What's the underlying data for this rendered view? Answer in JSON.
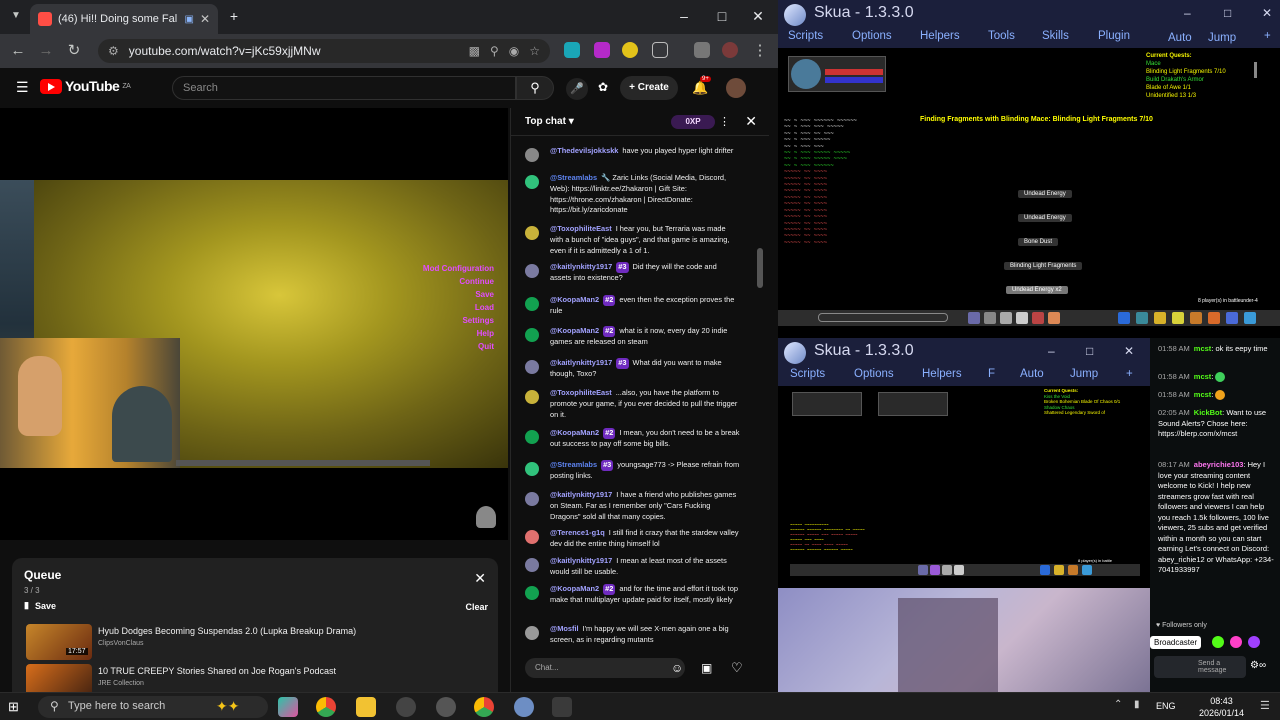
{
  "chrome": {
    "tab_title": "(46) Hi!! Doing some Fallout",
    "url": "youtube.com/watch?v=jKc59xjjMNw"
  },
  "youtube": {
    "logo": "YouTube",
    "region": "ZA",
    "search_placeholder": "Search",
    "create_label": "Create",
    "notif_count": "9+"
  },
  "video": {
    "game_menu": [
      "Mod Configuration",
      "Continue",
      "Save",
      "Load",
      "Settings",
      "Help",
      "Quit"
    ]
  },
  "queue": {
    "title": "Queue",
    "count": "3 / 3",
    "save": "Save",
    "clear": "Clear",
    "items": [
      {
        "title": "Hyub Dodges Becoming Suspendas 2.0 (Lupka Breakup Drama)",
        "channel": "ClipsVonClaus",
        "duration": "17:57"
      },
      {
        "title": "10 TRUE CREEPY Stories Shared on Joe Rogan's Podcast",
        "channel": "JRE Collection",
        "duration": ""
      }
    ]
  },
  "chat": {
    "header": "Top chat",
    "xp": "0XP",
    "input_placeholder": "Chat...",
    "messages": [
      {
        "author": "@Thedevilsjokkskk",
        "badge": "",
        "text": "have you played hyper light drifter"
      },
      {
        "author": "@Streamlabs",
        "badge": "",
        "text": "Zaric Links (Social Media, Discord, Web): https://linktr.ee/Zhakaron | Gift Site: https://throne.com/zhakaron | DirectDonate: https://bit.ly/zaricdonate"
      },
      {
        "author": "@ToxophiliteEast",
        "badge": "",
        "text": "I hear you, but Terraria was made with a bunch of \"idea guys\", and that game is amazing, even if it is admittedly a 1 of 1."
      },
      {
        "author": "@kaitlynkitty1917",
        "badge": "#3",
        "text": "Did they will the code and assets into existence?"
      },
      {
        "author": "@KoopaMan2",
        "badge": "#2",
        "text": "even then the exception proves the rule"
      },
      {
        "author": "@KoopaMan2",
        "badge": "#2",
        "text": "what is it now, every day 20 indie games are released on steam"
      },
      {
        "author": "@kaitlynkitty1917",
        "badge": "#3",
        "text": "What did you want to make though, Toxo?"
      },
      {
        "author": "@ToxophiliteEast",
        "badge": "",
        "text": "...also, you have the platform to promote your game, if you ever decided to pull the trigger on it."
      },
      {
        "author": "@KoopaMan2",
        "badge": "#2",
        "text": "I mean, you don't need to be a break out success to pay off some big bills."
      },
      {
        "author": "@Streamlabs",
        "badge": "#3",
        "text": "youngsage773 -> Please refrain from posting links."
      },
      {
        "author": "@kaitlynkitty1917",
        "badge": "",
        "text": "I have a friend who publishes games on Steam. Far as I remember only \"Cars Fucking Dragons\" sold all that many copies."
      },
      {
        "author": "@Terence1-g1q",
        "badge": "",
        "text": "I still find it crazy that the stardew valley dev did the entire thing himself lol"
      },
      {
        "author": "@kaitlynkitty1917",
        "badge": "",
        "text": "I mean at least most of the assets would still be usable."
      },
      {
        "author": "@KoopaMan2",
        "badge": "#2",
        "text": "and for the time and effort it took top make that multiplayer update paid for itself, mostly likely"
      },
      {
        "author": "@Mosfil",
        "badge": "",
        "text": "I'm happy we will see X-men again one a big screen, as in regarding mutants"
      }
    ]
  },
  "skua1": {
    "title": "Skua - 1.3.3.0",
    "menu": [
      "Scripts",
      "Options",
      "Helpers",
      "Tools",
      "Skills",
      "Plugin",
      "Auto",
      "Jump"
    ],
    "quest_header": "Current Quests:",
    "quests": [
      "Mace",
      "Blinding Light Fragments 7/10",
      "Build Drakath's Armor",
      "Blade of Awe 1/1",
      "Unidentified 13 1/3"
    ],
    "objective": "Finding Fragments with Blinding Mace: Blinding Light Fragments 7/10",
    "drops": [
      "Undead Energy",
      "Undead Energy",
      "Bone Dust",
      "Blinding Light Fragments",
      "Undead Energy x2"
    ],
    "players": "8 player(s) in battleunder-4"
  },
  "skua2": {
    "title": "Skua - 1.3.3.0",
    "menu": [
      "Scripts",
      "Options",
      "Helpers",
      "F",
      "Auto",
      "Jump"
    ],
    "quest_header": "Current Quests:",
    "quests": [
      "Kiss the Void",
      "Broken Bohemian Blade Of Chaos 0/1",
      "Shadow Chaos",
      "Shattered Legendary Sword of"
    ],
    "players": "8 player(s) in battle"
  },
  "kick": {
    "messages": [
      {
        "time": "01:58 AM",
        "user": "mcst",
        "text": "ok its eepy time"
      },
      {
        "time": "01:58 AM",
        "user": "mcst",
        "text": ""
      },
      {
        "time": "01:58 AM",
        "user": "mcst",
        "text": ""
      },
      {
        "time": "02:05 AM",
        "user": "KickBot",
        "text": "Want to use Sound Alerts? Chose here: https://blerp.com/x/mcst"
      },
      {
        "time": "08:17 AM",
        "user": "abeyrichie103",
        "text": "Hey I love your streaming content welcome to Kick! I help new streamers grow fast with real followers and viewers I can help you reach 1.5k followers, 100 live viewers, 25 subs and get verified within a month so you can start earning Let's connect on Discord: abey_richie12 or WhatsApp: +234-7041933997"
      }
    ],
    "followers_only": "Followers only",
    "broadcaster": "Broadcaster",
    "send_placeholder": "Send a message"
  },
  "taskbar": {
    "search_placeholder": "Type here to search",
    "lang": "ENG",
    "time": "08:43",
    "date": "2026/01/14"
  }
}
